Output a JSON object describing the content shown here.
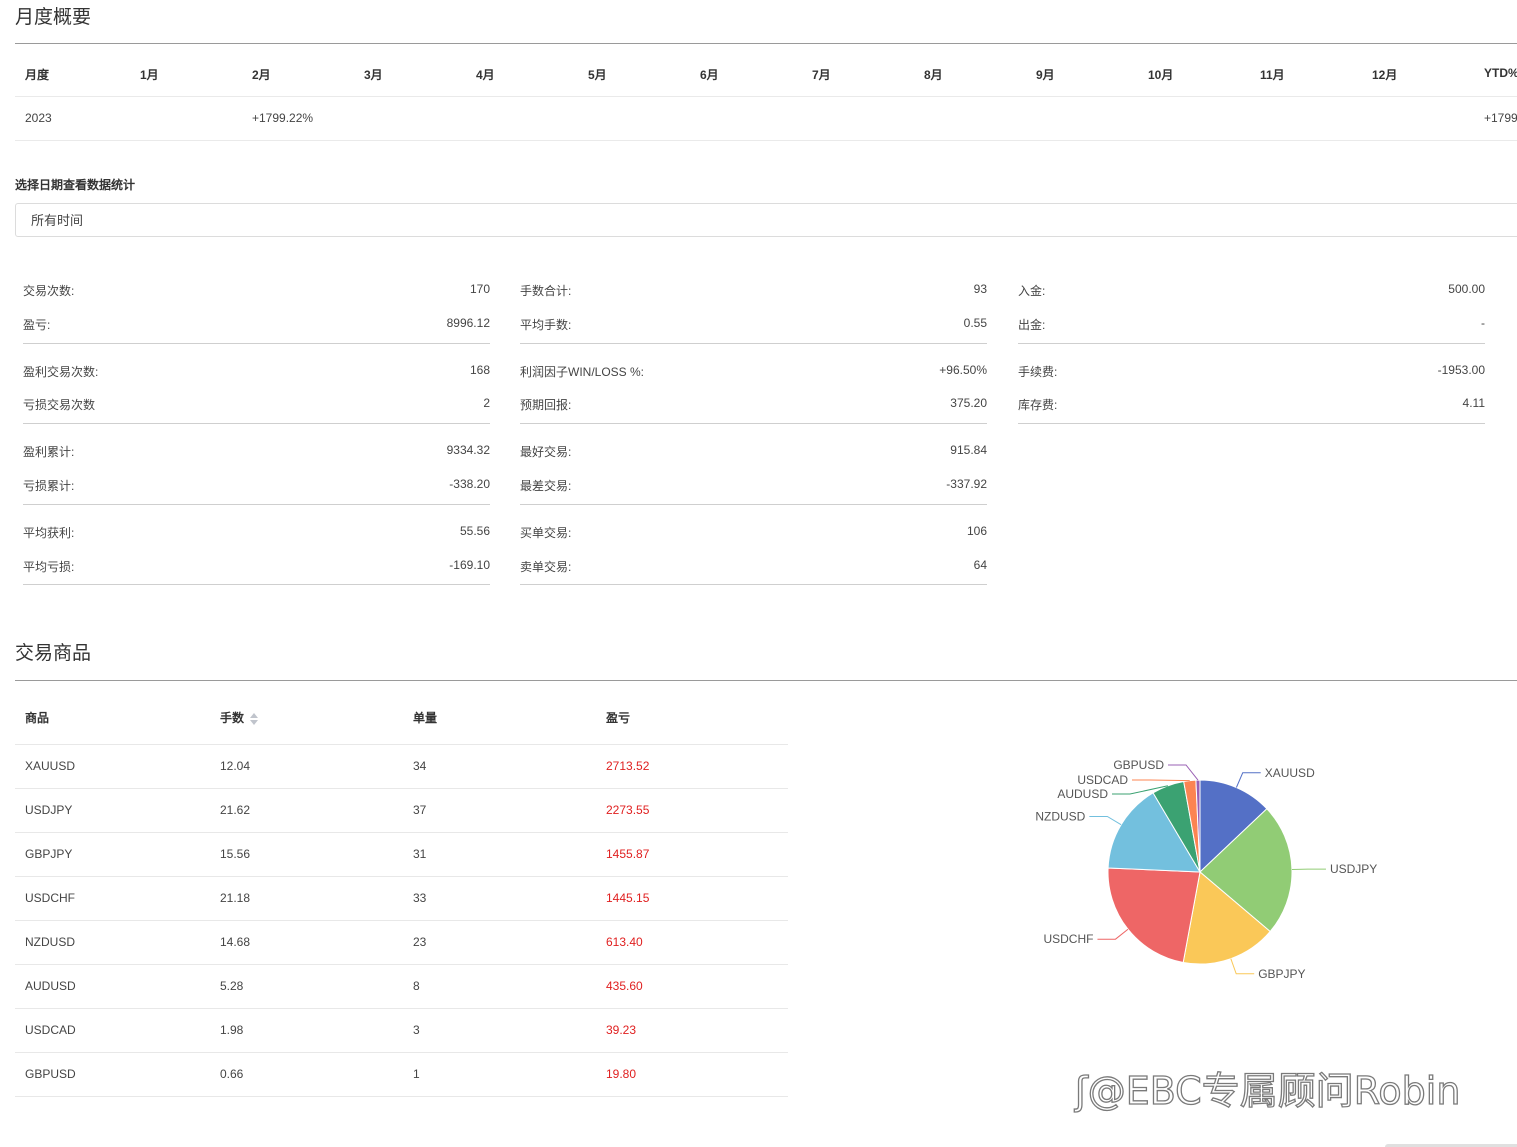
{
  "monthly": {
    "title": "月度概要",
    "headers": [
      "月度",
      "1月",
      "2月",
      "3月",
      "4月",
      "5月",
      "6月",
      "7月",
      "8月",
      "9月",
      "10月",
      "11月",
      "12月",
      "YTD%"
    ],
    "row": {
      "year": "2023",
      "feb": "+1799.22%",
      "ytd": "+1799"
    }
  },
  "filter": {
    "label": "选择日期查看数据统计",
    "selected": "所有时间"
  },
  "stats": {
    "col1": [
      {
        "label": "交易次数:",
        "value": "170"
      },
      {
        "label": "盈亏:",
        "value": "8996.12"
      },
      {
        "label": "盈利交易次数:",
        "value": "168"
      },
      {
        "label": "亏损交易次数",
        "value": "2"
      },
      {
        "label": "盈利累计:",
        "value": "9334.32"
      },
      {
        "label": "亏损累计:",
        "value": "-338.20"
      },
      {
        "label": "平均获利:",
        "value": "55.56"
      },
      {
        "label": "平均亏损:",
        "value": "-169.10"
      }
    ],
    "col2": [
      {
        "label": "手数合计:",
        "value": "93"
      },
      {
        "label": "平均手数:",
        "value": "0.55"
      },
      {
        "label": "利润因子WIN/LOSS %:",
        "value": "+96.50%"
      },
      {
        "label": "预期回报:",
        "value": "375.20"
      },
      {
        "label": "最好交易:",
        "value": "915.84"
      },
      {
        "label": "最差交易:",
        "value": "-337.92"
      },
      {
        "label": "买单交易:",
        "value": "106"
      },
      {
        "label": "卖单交易:",
        "value": "64"
      }
    ],
    "col3": [
      {
        "label": "入金:",
        "value": "500.00"
      },
      {
        "label": "出金:",
        "value": "-"
      },
      {
        "label": "手续费:",
        "value": "-1953.00"
      },
      {
        "label": "库存费:",
        "value": "4.11"
      }
    ]
  },
  "instruments": {
    "title": "交易商品",
    "headers": {
      "symbol": "商品",
      "lots": "手数",
      "orders": "单量",
      "pnl": "盈亏"
    },
    "sort_icon": "sort-caret-icon",
    "rows": [
      {
        "symbol": "XAUUSD",
        "lots": "12.04",
        "orders": "34",
        "pnl": "2713.52"
      },
      {
        "symbol": "USDJPY",
        "lots": "21.62",
        "orders": "37",
        "pnl": "2273.55"
      },
      {
        "symbol": "GBPJPY",
        "lots": "15.56",
        "orders": "31",
        "pnl": "1455.87"
      },
      {
        "symbol": "USDCHF",
        "lots": "21.18",
        "orders": "33",
        "pnl": "1445.15"
      },
      {
        "symbol": "NZDUSD",
        "lots": "14.68",
        "orders": "23",
        "pnl": "613.40"
      },
      {
        "symbol": "AUDUSD",
        "lots": "5.28",
        "orders": "8",
        "pnl": "435.60"
      },
      {
        "symbol": "USDCAD",
        "lots": "1.98",
        "orders": "3",
        "pnl": "39.23"
      },
      {
        "symbol": "GBPUSD",
        "lots": "0.66",
        "orders": "1",
        "pnl": "19.80"
      }
    ]
  },
  "chart_data": {
    "type": "pie",
    "categories": [
      "XAUUSD",
      "USDJPY",
      "GBPJPY",
      "USDCHF",
      "NZDUSD",
      "AUDUSD",
      "USDCAD",
      "GBPUSD"
    ],
    "values": [
      12.04,
      21.62,
      15.56,
      21.18,
      14.68,
      5.28,
      1.98,
      0.66
    ],
    "colors": [
      "#5470c6",
      "#91cc75",
      "#fac858",
      "#ee6666",
      "#73c0de",
      "#3ba272",
      "#fc8452",
      "#9a60b4"
    ]
  },
  "colors": {
    "positive_pnl": "#e02020",
    "rule": "#9a9a9a"
  },
  "watermark": {
    "icon": "app-logo-icon",
    "text": "@EBC专属顾问Robin"
  }
}
